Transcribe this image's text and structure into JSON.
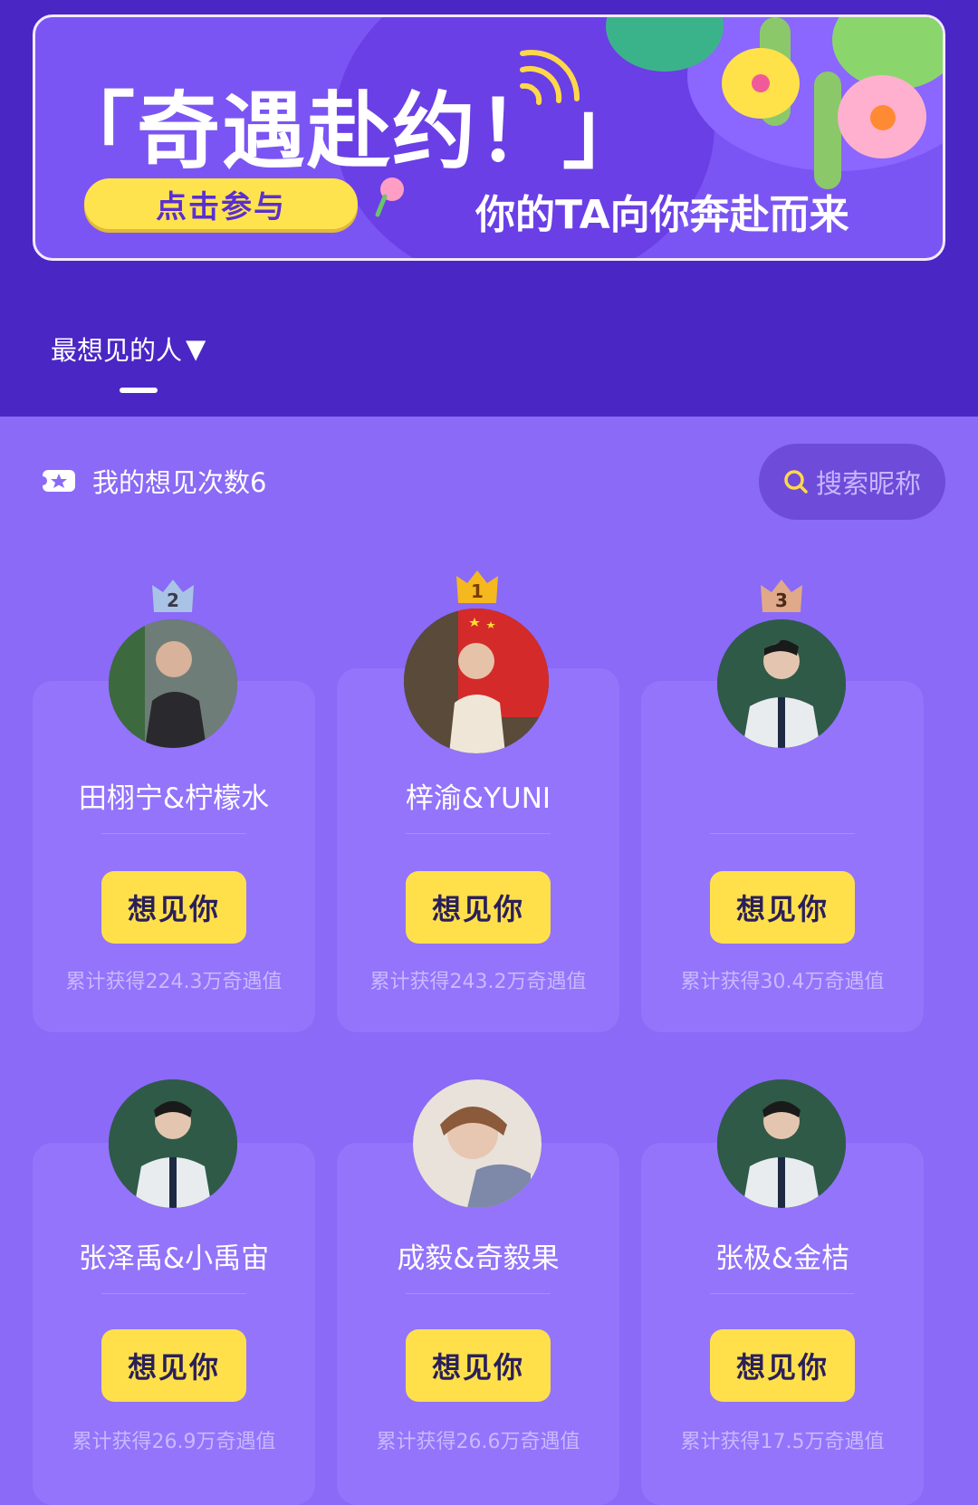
{
  "banner": {
    "title": "「奇遇赴约！」",
    "join_label": "点击参与",
    "subtitle": "你的TA向你奔赴而来"
  },
  "tab": {
    "label": "最想见的人",
    "arrow": "▼"
  },
  "my_count": {
    "label": "我的想见次数6"
  },
  "search": {
    "placeholder": "搜索昵称"
  },
  "colors": {
    "page_bg": "#8a6af6",
    "top_bg": "#4a26c4",
    "button_yellow": "#ffe04a",
    "gold_crown": "#f5b81f",
    "silver_crown": "#a9c3e6",
    "bronze_crown": "#e0a989"
  },
  "cards": [
    {
      "rank": "2",
      "name": "田栩宁&柠檬水",
      "button": "想见你",
      "accum": "累计获得224.3万奇遇值",
      "avatar_icon": "person-photo"
    },
    {
      "rank": "1",
      "name": "梓渝&YUNI",
      "button": "想见你",
      "accum": "累计获得243.2万奇遇值",
      "avatar_icon": "person-photo"
    },
    {
      "rank": "3",
      "name": "",
      "button": "想见你",
      "accum": "累计获得30.4万奇遇值",
      "avatar_icon": "person-photo"
    },
    {
      "rank": "",
      "name": "张泽禹&小禹宙",
      "button": "想见你",
      "accum": "累计获得26.9万奇遇值",
      "avatar_icon": "person-photo"
    },
    {
      "rank": "",
      "name": "成毅&奇毅果",
      "button": "想见你",
      "accum": "累计获得26.6万奇遇值",
      "avatar_icon": "person-photo"
    },
    {
      "rank": "",
      "name": "张极&金桔",
      "button": "想见你",
      "accum": "累计获得17.5万奇遇值",
      "avatar_icon": "person-photo"
    }
  ]
}
